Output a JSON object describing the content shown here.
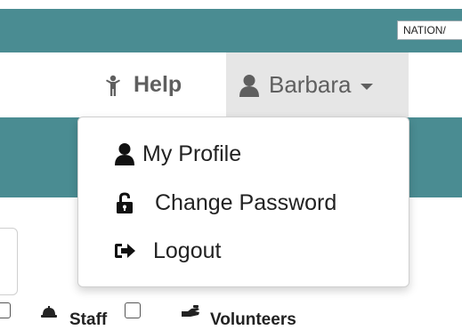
{
  "header": {
    "badge_text": "NATION/"
  },
  "nav": {
    "help_label": "Help",
    "user_label": "Barbara"
  },
  "user_menu": {
    "items": [
      {
        "label": "My Profile",
        "icon": "user-icon"
      },
      {
        "label": "Change Password",
        "icon": "unlock-icon"
      },
      {
        "label": "Logout",
        "icon": "sign-out-icon"
      }
    ]
  },
  "filters": {
    "staff_label": "Staff",
    "volunteers_label": "Volunteers"
  },
  "colors": {
    "teal": "#4a8c92",
    "menu_hover": "#e6e6e6",
    "text_gray": "#5f5f5f"
  }
}
